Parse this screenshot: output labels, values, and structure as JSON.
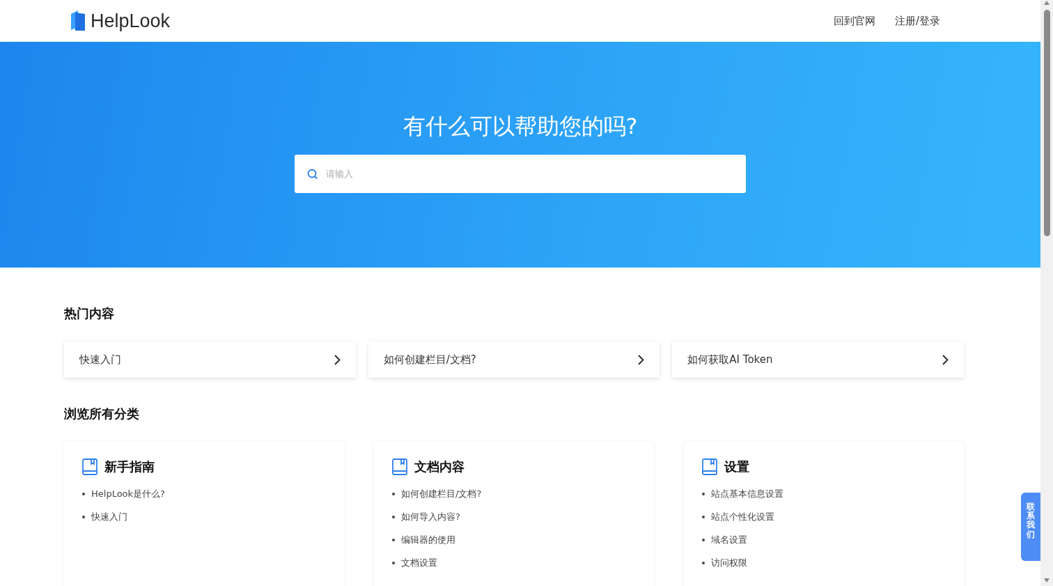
{
  "header": {
    "logo": "HelpLook",
    "nav": [
      "回到官网",
      "注册/登录"
    ]
  },
  "hero": {
    "title": "有什么可以帮助您的吗?",
    "search": {
      "placeholder": "请输入"
    }
  },
  "hot": {
    "title": "热门内容",
    "items": [
      "快速入门",
      "如何创建栏目/文档?",
      "如何获取AI Token"
    ]
  },
  "categories": {
    "title": "浏览所有分类",
    "items": [
      {
        "name": "新手指南",
        "links": [
          "HelpLook是什么?",
          "快速入门"
        ]
      },
      {
        "name": "文档内容",
        "links": [
          "如何创建栏目/文档?",
          "如何导入内容?",
          "编辑器的使用",
          "文档设置"
        ]
      },
      {
        "name": "设置",
        "links": [
          "站点基本信息设置",
          "站点个性化设置",
          "域名设置",
          "访问权限"
        ]
      }
    ]
  },
  "contact": {
    "label": "联系我们"
  }
}
